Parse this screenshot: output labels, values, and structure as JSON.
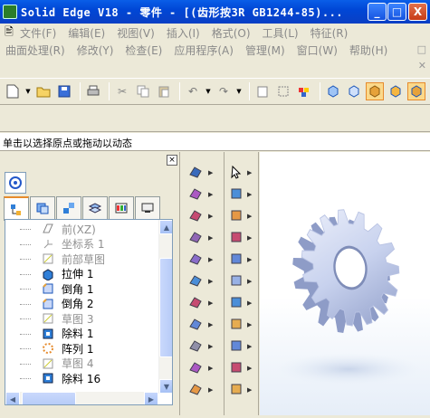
{
  "window": {
    "title": "Solid Edge V18 - 零件 - [(齿形按3R GB1244-85)...",
    "minimize": "_",
    "maximize": "□",
    "close": "X"
  },
  "menubar1": [
    "文件(F)",
    "编辑(E)",
    "视图(V)",
    "插入(I)",
    "格式(O)",
    "工具(L)",
    "特征(R)"
  ],
  "menubar2": [
    "曲面处理(R)",
    "修改(Y)",
    "检查(E)",
    "应用程序(A)",
    "管理(M)",
    "窗口(W)",
    "帮助(H)"
  ],
  "mdi_close": "✕",
  "status_text": "单击以选择原点或拖动以动态",
  "pathfinder": {
    "close_label": "×",
    "tree_items": [
      {
        "label": "前(XZ)",
        "style": "dim",
        "icon": "plane-icon"
      },
      {
        "label": "坐标系 1",
        "style": "dim",
        "icon": "coordinate-system-icon"
      },
      {
        "label": "前部草图",
        "style": "dim",
        "icon": "sketch-icon"
      },
      {
        "label": "拉伸 1",
        "style": "norm",
        "icon": "extrude-icon"
      },
      {
        "label": "倒角 1",
        "style": "norm",
        "icon": "chamfer-icon"
      },
      {
        "label": "倒角 2",
        "style": "norm",
        "icon": "chamfer-icon"
      },
      {
        "label": "草图 3",
        "style": "dim",
        "icon": "sketch-icon"
      },
      {
        "label": "除料 1",
        "style": "norm",
        "icon": "cutout-icon"
      },
      {
        "label": "阵列 1",
        "style": "norm",
        "icon": "pattern-icon"
      },
      {
        "label": "草图 4",
        "style": "dim",
        "icon": "sketch-icon"
      },
      {
        "label": "除料 16",
        "style": "norm",
        "icon": "cutout-icon"
      }
    ]
  },
  "colors": {
    "title_bar": "#0a5ee8",
    "gear": "#c8d2ee",
    "accent": "#e68b2c"
  }
}
